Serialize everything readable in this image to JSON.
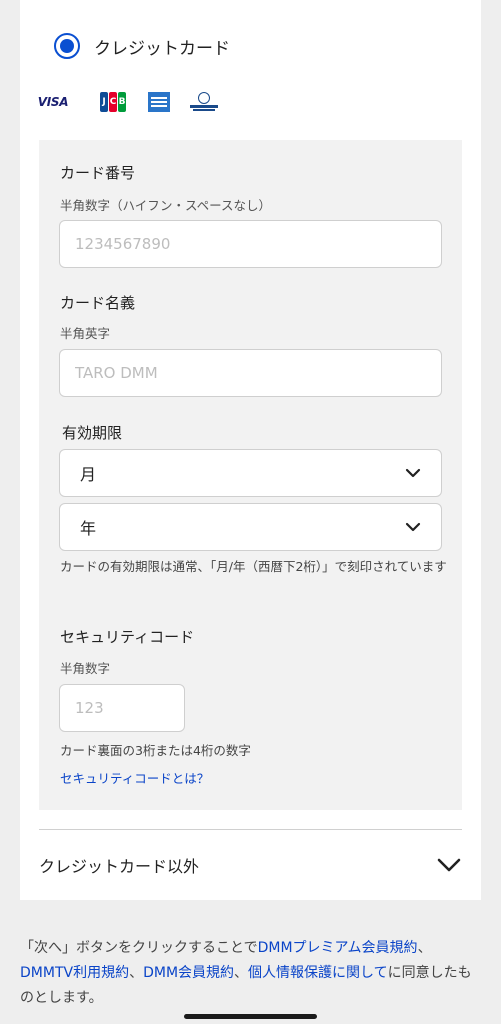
{
  "payment": {
    "method_label": "クレジットカード",
    "brands": [
      "VISA",
      "JCB",
      "AMERICAN EXPRESS",
      "Diners Club"
    ]
  },
  "form": {
    "card_number": {
      "label": "カード番号",
      "hint": "半角数字（ハイフン・スペースなし）",
      "placeholder": "1234567890"
    },
    "card_name": {
      "label": "カード名義",
      "hint": "半角英字",
      "placeholder": "TARO DMM"
    },
    "expiry": {
      "label": "有効期限",
      "month_value": "月",
      "year_value": "年",
      "note": "カードの有効期限は通常、「月/年（西暦下2桁）」で刻印されています"
    },
    "security_code": {
      "label": "セキュリティコード",
      "hint": "半角数字",
      "placeholder": "123",
      "note": "カード裏面の3桁または4桁の数字",
      "help_link": "セキュリティコードとは？"
    }
  },
  "other_methods": {
    "label": "クレジットカード以外"
  },
  "footer": {
    "prefix": "「次へ」ボタンをクリックすることで",
    "link_premium": "DMMプレミアム会員規約",
    "sep1": "、",
    "link_tv": "DMMTV利用規約",
    "sep2": "、",
    "link_member": "DMM会員規約",
    "sep3": "、",
    "link_privacy": "個人情報保護に関して",
    "suffix": "に同意したものとします。"
  },
  "colors": {
    "accent": "#0a4fd1",
    "link": "#0a44c8",
    "panel": "#f2f2f2",
    "background": "#eeeeee"
  }
}
